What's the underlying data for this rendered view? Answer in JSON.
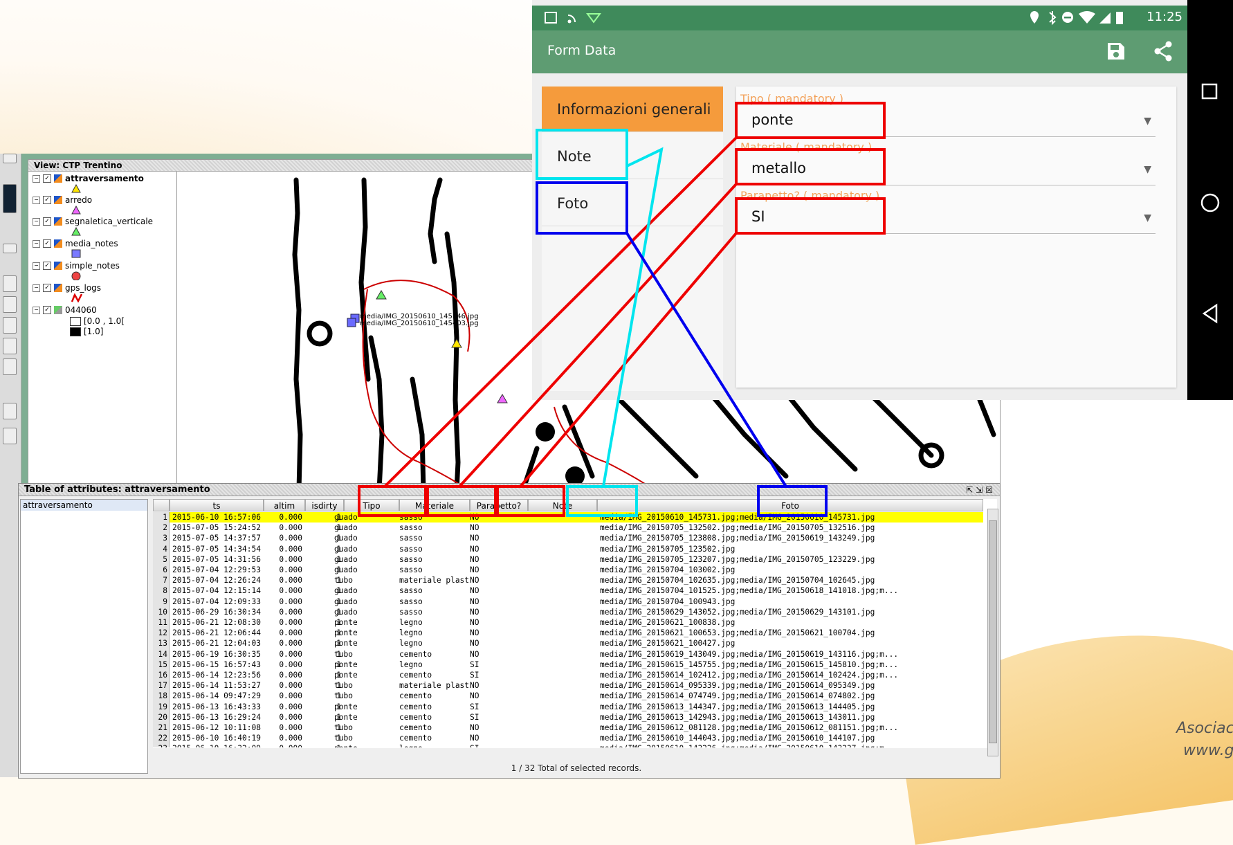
{
  "slide": {
    "footer_line1": "Asociació",
    "footer_line2": "www.gv"
  },
  "gis": {
    "view_title": "View: CTP Trentino",
    "layers": [
      {
        "name": "attraversamento",
        "checked": true,
        "bold": true
      },
      {
        "name": "arredo",
        "checked": true
      },
      {
        "name": "segnaletica_verticale",
        "checked": true
      },
      {
        "name": "media_notes",
        "checked": true
      },
      {
        "name": "simple_notes",
        "checked": true
      },
      {
        "name": "gps_logs",
        "checked": true
      },
      {
        "name": "044060",
        "checked": true
      }
    ],
    "legend_ranges": [
      "[0.0 , 1.0[",
      "[1.0]"
    ],
    "map_labels": [
      "media/IMG_20150610_145546.jpg",
      "media/IMG_20150610_145403.jpg"
    ]
  },
  "table": {
    "title": "Table of attributes: attraversamento",
    "list_item": "attraversamento",
    "columns": [
      "ts",
      "altim",
      "isdirty",
      "Tipo",
      "Materiale",
      "Parapetto?",
      "Note",
      "Foto"
    ],
    "rows": [
      [
        "2015-06-10 16:57:06",
        "0.000",
        "1",
        "guado",
        "sasso",
        "NO",
        "",
        "media/IMG_20150610_145731.jpg;media/IMG_20150610_145731.jpg"
      ],
      [
        "2015-07-05 15:24:52",
        "0.000",
        "1",
        "guado",
        "sasso",
        "NO",
        "",
        "media/IMG_20150705_132502.jpg;media/IMG_20150705_132516.jpg"
      ],
      [
        "2015-07-05 14:37:57",
        "0.000",
        "1",
        "guado",
        "sasso",
        "NO",
        "",
        "media/IMG_20150705_123808.jpg;media/IMG_20150619_143249.jpg"
      ],
      [
        "2015-07-05 14:34:54",
        "0.000",
        "1",
        "guado",
        "sasso",
        "NO",
        "",
        "media/IMG_20150705_123502.jpg"
      ],
      [
        "2015-07-05 14:31:56",
        "0.000",
        "1",
        "guado",
        "sasso",
        "NO",
        "",
        "media/IMG_20150705_123207.jpg;media/IMG_20150705_123229.jpg"
      ],
      [
        "2015-07-04 12:29:53",
        "0.000",
        "1",
        "guado",
        "sasso",
        "NO",
        "",
        "media/IMG_20150704_103002.jpg"
      ],
      [
        "2015-07-04 12:26:24",
        "0.000",
        "1",
        "tubo",
        "materiale plastico",
        "NO",
        "",
        "media/IMG_20150704_102635.jpg;media/IMG_20150704_102645.jpg"
      ],
      [
        "2015-07-04 12:15:14",
        "0.000",
        "1",
        "guado",
        "sasso",
        "NO",
        "",
        "media/IMG_20150704_101525.jpg;media/IMG_20150618_141018.jpg;m..."
      ],
      [
        "2015-07-04 12:09:33",
        "0.000",
        "1",
        "guado",
        "sasso",
        "NO",
        "",
        "media/IMG_20150704_100943.jpg"
      ],
      [
        "2015-06-29 16:30:34",
        "0.000",
        "1",
        "guado",
        "sasso",
        "NO",
        "",
        "media/IMG_20150629_143052.jpg;media/IMG_20150629_143101.jpg"
      ],
      [
        "2015-06-21 12:08:30",
        "0.000",
        "1",
        "ponte",
        "legno",
        "NO",
        "",
        "media/IMG_20150621_100838.jpg"
      ],
      [
        "2015-06-21 12:06:44",
        "0.000",
        "1",
        "ponte",
        "legno",
        "NO",
        "",
        "media/IMG_20150621_100653.jpg;media/IMG_20150621_100704.jpg"
      ],
      [
        "2015-06-21 12:04:03",
        "0.000",
        "1",
        "ponte",
        "legno",
        "NO",
        "",
        "media/IMG_20150621_100427.jpg"
      ],
      [
        "2015-06-19 16:30:35",
        "0.000",
        "1",
        "tubo",
        "cemento",
        "NO",
        "",
        "media/IMG_20150619_143049.jpg;media/IMG_20150619_143116.jpg;m..."
      ],
      [
        "2015-06-15 16:57:43",
        "0.000",
        "1",
        "ponte",
        "legno",
        "SI",
        "",
        "media/IMG_20150615_145755.jpg;media/IMG_20150615_145810.jpg;m..."
      ],
      [
        "2015-06-14 12:23:56",
        "0.000",
        "1",
        "ponte",
        "cemento",
        "SI",
        "",
        "media/IMG_20150614_102412.jpg;media/IMG_20150614_102424.jpg;m..."
      ],
      [
        "2015-06-14 11:53:27",
        "0.000",
        "1",
        "tubo",
        "materiale plastico",
        "NO",
        "",
        "media/IMG_20150614_095339.jpg;media/IMG_20150614_095349.jpg"
      ],
      [
        "2015-06-14 09:47:29",
        "0.000",
        "1",
        "tubo",
        "cemento",
        "NO",
        "",
        "media/IMG_20150614_074749.jpg;media/IMG_20150614_074802.jpg"
      ],
      [
        "2015-06-13 16:43:33",
        "0.000",
        "1",
        "ponte",
        "cemento",
        "SI",
        "",
        "media/IMG_20150613_144347.jpg;media/IMG_20150613_144405.jpg"
      ],
      [
        "2015-06-13 16:29:24",
        "0.000",
        "1",
        "ponte",
        "cemento",
        "SI",
        "",
        "media/IMG_20150613_142943.jpg;media/IMG_20150613_143011.jpg"
      ],
      [
        "2015-06-12 10:11:08",
        "0.000",
        "1",
        "tubo",
        "cemento",
        "NO",
        "",
        "media/IMG_20150612_081128.jpg;media/IMG_20150612_081151.jpg;m..."
      ],
      [
        "2015-06-10 16:40:19",
        "0.000",
        "1",
        "tubo",
        "cemento",
        "NO",
        "",
        "media/IMG_20150610_144043.jpg;media/IMG_20150610_144107.jpg"
      ],
      [
        "2015-06-10 16:32:09",
        "0.000",
        "1",
        "ponte",
        "legno",
        "SI",
        "",
        "media/IMG_20150610_143226.jpg;media/IMG_20150610_143237.jpg;m..."
      ]
    ],
    "status": "1 / 32 Total of selected records."
  },
  "phone": {
    "time": "11:25",
    "app_title": "Form Data",
    "tabs": [
      "Informazioni generali",
      "Note",
      "Foto"
    ],
    "fields": [
      {
        "label": "Tipo ( mandatory )",
        "value": "ponte"
      },
      {
        "label": "Materiale ( mandatory )",
        "value": "metallo"
      },
      {
        "label": "Parapetto? ( mandatory )",
        "value": "SI"
      }
    ]
  },
  "colors": {
    "highlight_row": "#ffff00",
    "app_green": "#5e9c72",
    "status_green": "#3f8a5b",
    "active_tab": "#f59b3c",
    "annot_red": "#ee0000",
    "annot_blue": "#0000ee",
    "annot_cyan": "#00e5ee"
  }
}
